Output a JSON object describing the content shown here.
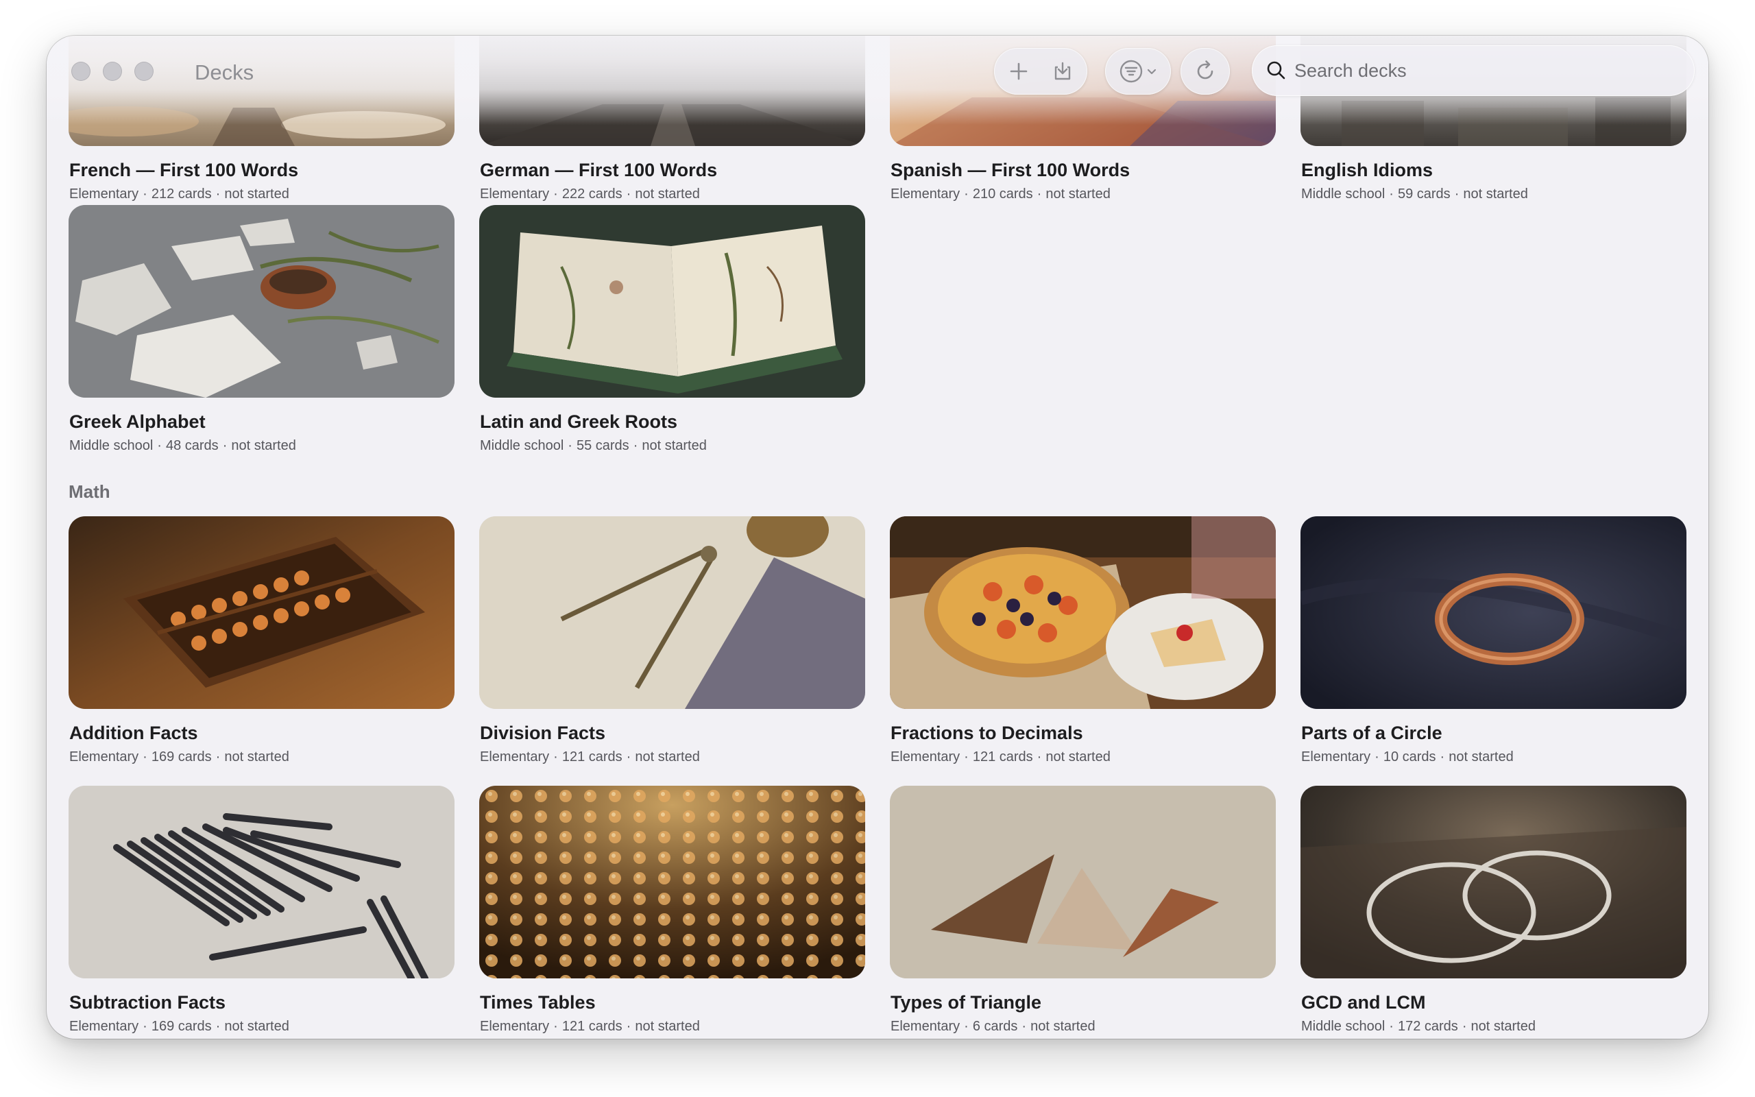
{
  "window": {
    "title": "Decks"
  },
  "toolbar": {
    "add_icon": "plus-icon",
    "import_icon": "tray-arrow-down-icon",
    "filter_icon": "filter-lines-circle-icon",
    "filter_chevron_icon": "chevron-down-icon",
    "refresh_icon": "arrow-clockwise-icon"
  },
  "search": {
    "placeholder": "Search decks",
    "value": ""
  },
  "sections": {
    "math": "Math"
  },
  "meta_separator": "·",
  "decks": [
    {
      "title": "French — First 100 Words",
      "level": "Elementary",
      "cards": "212 cards",
      "status": "not started"
    },
    {
      "title": "German — First 100 Words",
      "level": "Elementary",
      "cards": "222 cards",
      "status": "not started"
    },
    {
      "title": "Spanish — First 100 Words",
      "level": "Elementary",
      "cards": "210 cards",
      "status": "not started"
    },
    {
      "title": "English Idioms",
      "level": "Middle school",
      "cards": "59 cards",
      "status": "not started"
    },
    {
      "title": "Greek Alphabet",
      "level": "Middle school",
      "cards": "48 cards",
      "status": "not started"
    },
    {
      "title": "Latin and Greek Roots",
      "level": "Middle school",
      "cards": "55 cards",
      "status": "not started"
    },
    {
      "title": "Addition Facts",
      "level": "Elementary",
      "cards": "169 cards",
      "status": "not started"
    },
    {
      "title": "Division Facts",
      "level": "Elementary",
      "cards": "121 cards",
      "status": "not started"
    },
    {
      "title": "Fractions to Decimals",
      "level": "Elementary",
      "cards": "121 cards",
      "status": "not started"
    },
    {
      "title": "Parts of a Circle",
      "level": "Elementary",
      "cards": "10 cards",
      "status": "not started"
    },
    {
      "title": "Subtraction Facts",
      "level": "Elementary",
      "cards": "169 cards",
      "status": "not started"
    },
    {
      "title": "Times Tables",
      "level": "Elementary",
      "cards": "121 cards",
      "status": "not started"
    },
    {
      "title": "Types of Triangle",
      "level": "Elementary",
      "cards": "6 cards",
      "status": "not started"
    },
    {
      "title": "GCD and LCM",
      "level": "Middle school",
      "cards": "172 cards",
      "status": "not started"
    }
  ]
}
